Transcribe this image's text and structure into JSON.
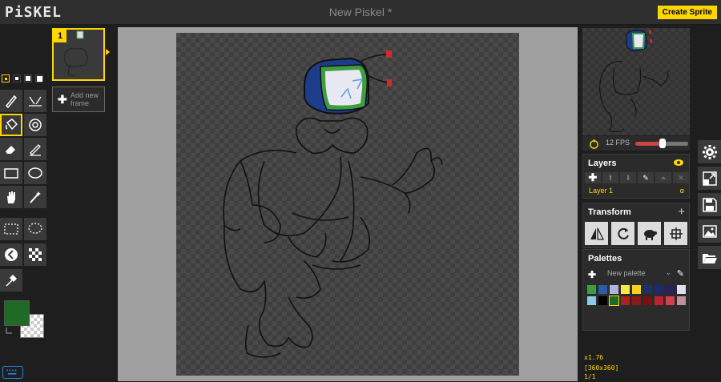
{
  "app": {
    "logo": "PiSKEL",
    "document_title": "New Piskel *",
    "create_sprite_label": "Create Sprite"
  },
  "tools": {
    "pen_sizes": [
      1,
      2,
      3,
      4
    ],
    "selected_pen_size": 1,
    "items": [
      {
        "name": "pen-tool",
        "icon": "pen-icon"
      },
      {
        "name": "mirror-pen-tool",
        "icon": "mirror-pen-icon"
      },
      {
        "name": "paint-bucket-tool",
        "icon": "paint-bucket-icon",
        "selected": true
      },
      {
        "name": "paint-all-same-color-tool",
        "icon": "magic-bucket-icon"
      },
      {
        "name": "eraser-tool",
        "icon": "eraser-icon"
      },
      {
        "name": "stroke-tool",
        "icon": "stroke-icon"
      },
      {
        "name": "rectangle-tool",
        "icon": "rectangle-icon"
      },
      {
        "name": "circle-tool",
        "icon": "circle-icon"
      },
      {
        "name": "move-tool",
        "icon": "hand-icon"
      },
      {
        "name": "shape-selection-tool",
        "icon": "magic-wand-icon"
      },
      {
        "name": "rectangle-selection-tool",
        "icon": "rectangle-selection-icon"
      },
      {
        "name": "lasso-selection-tool",
        "icon": "lasso-icon"
      },
      {
        "name": "lighten-tool",
        "icon": "lighten-icon"
      },
      {
        "name": "dithering-tool",
        "icon": "dithering-icon"
      },
      {
        "name": "color-picker-tool",
        "icon": "eyedropper-icon"
      }
    ],
    "primary_color": "#1f6b26",
    "secondary_color": "transparent"
  },
  "frames": {
    "items": [
      {
        "number": "1"
      }
    ],
    "add_frame_label": "Add new frame"
  },
  "preview": {
    "fps_label": "12 FPS",
    "fps": 12
  },
  "layers": {
    "title": "Layers",
    "items": [
      {
        "name": "Layer 1",
        "opacity": "α"
      }
    ]
  },
  "transform": {
    "title": "Transform"
  },
  "palettes": {
    "title": "Palettes",
    "selected": "New palette",
    "colors": [
      "#3f9d3f",
      "#2e5aa8",
      "#a9b4e0",
      "#f5e84a",
      "#f5d020",
      "#1e2f6b",
      "#1e2a73",
      "#2a2060",
      "#e0e0f0",
      "#8ccbe8",
      "#000000",
      "#1f6b26",
      "#b02020",
      "#8a1a1a",
      "#7a1010",
      "#c02030",
      "#d04050",
      "#c090a0"
    ]
  },
  "side_actions": [
    {
      "name": "settings-button",
      "icon": "gear-icon"
    },
    {
      "name": "resize-button",
      "icon": "resize-icon"
    },
    {
      "name": "save-button",
      "icon": "save-icon"
    },
    {
      "name": "export-button",
      "icon": "image-icon"
    },
    {
      "name": "import-button",
      "icon": "folder-icon"
    }
  ],
  "status": {
    "zoom": "x1.76",
    "size": "[360x360]",
    "frame": "1/1"
  }
}
